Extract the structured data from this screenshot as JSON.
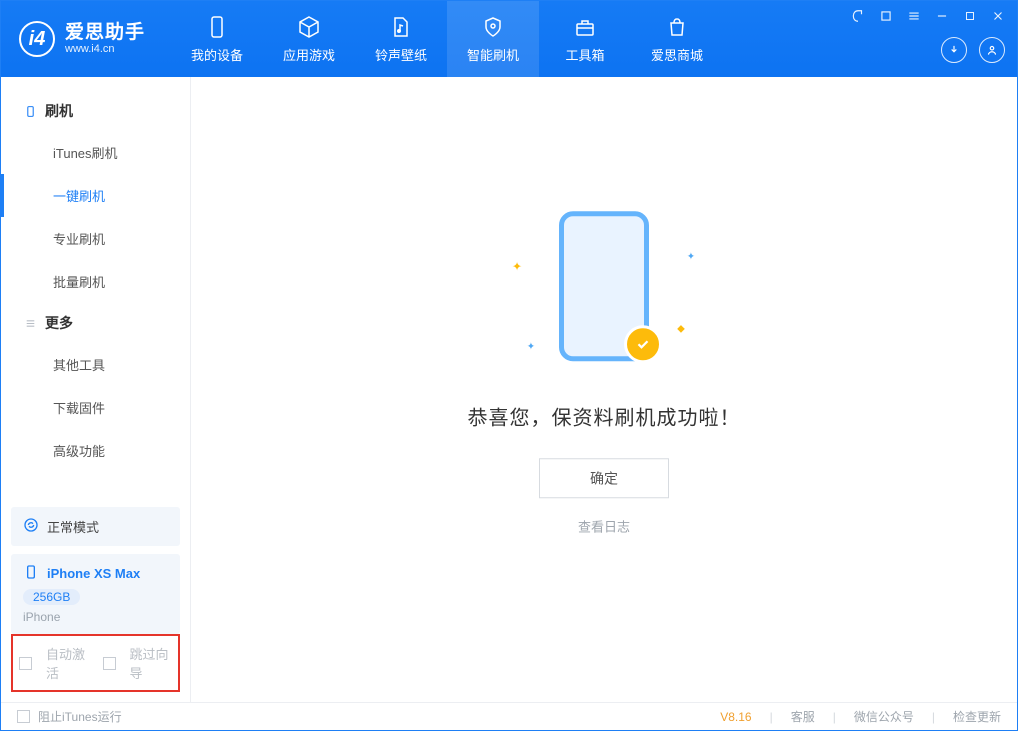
{
  "header": {
    "brand_title": "爱思助手",
    "brand_url": "www.i4.cn",
    "nav": [
      {
        "label": "我的设备"
      },
      {
        "label": "应用游戏"
      },
      {
        "label": "铃声壁纸"
      },
      {
        "label": "智能刷机"
      },
      {
        "label": "工具箱"
      },
      {
        "label": "爱思商城"
      }
    ]
  },
  "sidebar": {
    "group1_title": "刷机",
    "group1_items": [
      {
        "label": "iTunes刷机"
      },
      {
        "label": "一键刷机"
      },
      {
        "label": "专业刷机"
      },
      {
        "label": "批量刷机"
      }
    ],
    "group2_title": "更多",
    "group2_items": [
      {
        "label": "其他工具"
      },
      {
        "label": "下载固件"
      },
      {
        "label": "高级功能"
      }
    ],
    "mode_card": {
      "label": "正常模式"
    },
    "device_card": {
      "name": "iPhone XS Max",
      "storage": "256GB",
      "type": "iPhone"
    }
  },
  "options": {
    "auto_activate": "自动激活",
    "skip_wizard": "跳过向导"
  },
  "content": {
    "success_message": "恭喜您，保资料刷机成功啦！",
    "confirm_button": "确定",
    "view_log": "查看日志"
  },
  "footer": {
    "block_itunes": "阻止iTunes运行",
    "version": "V8.16",
    "links": [
      "客服",
      "微信公众号",
      "检查更新"
    ]
  }
}
